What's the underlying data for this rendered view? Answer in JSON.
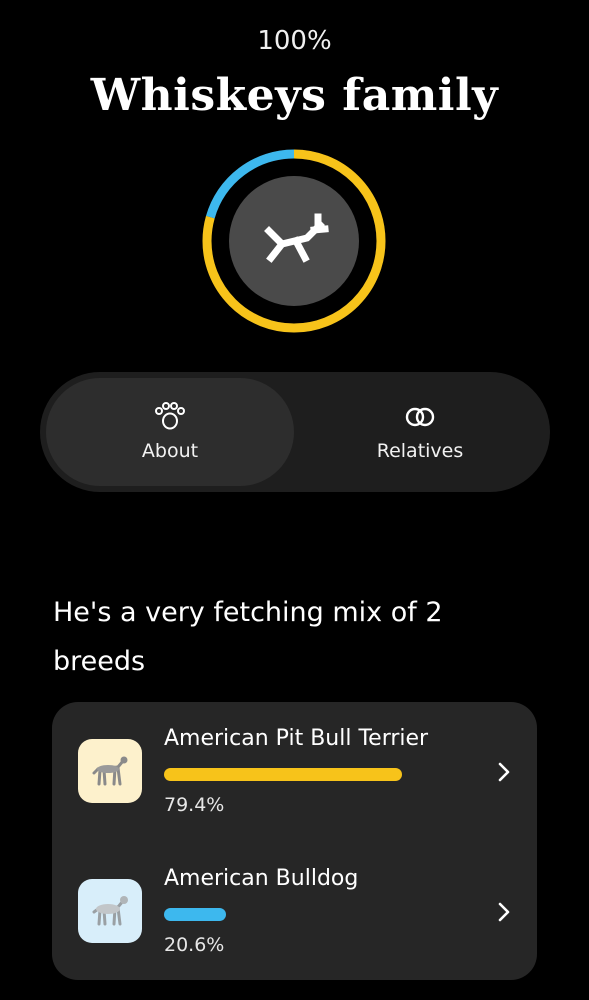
{
  "header": {
    "percent": "100%",
    "title": "Whiskeys family"
  },
  "ring": {
    "segments": [
      {
        "color": "#f7c31a",
        "fraction": 0.794
      },
      {
        "color": "#3db8ee",
        "fraction": 0.206
      }
    ],
    "avatar_icon": "dog-silhouette-icon"
  },
  "tabs": [
    {
      "label": "About",
      "icon": "paw-icon",
      "selected": true
    },
    {
      "label": "Relatives",
      "icon": "linked-rings-icon",
      "selected": false
    }
  ],
  "headline": "He's a very fetching mix of 2 breeds",
  "breeds": [
    {
      "name": "American Pit Bull Terrier",
      "percent_text": "79.4%",
      "fraction": 0.794,
      "color": "#f7c31a",
      "thumb_bg": "#fdf1cc",
      "icon": "dog-thumbnail-icon"
    },
    {
      "name": "American Bulldog",
      "percent_text": "20.6%",
      "fraction": 0.206,
      "color": "#3db8ee",
      "thumb_bg": "#d8eefa",
      "icon": "dog-thumbnail-icon"
    }
  ]
}
